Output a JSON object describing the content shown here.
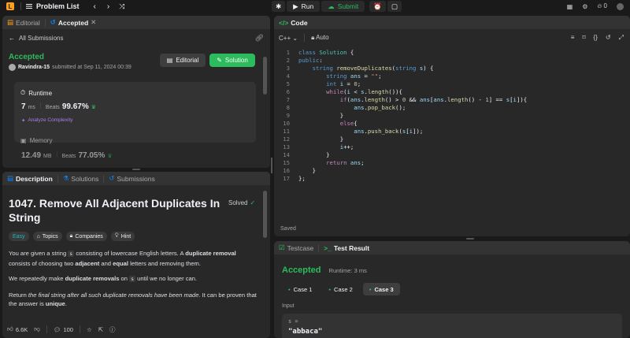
{
  "topbar": {
    "problem_list": "Problem List",
    "run": "Run",
    "submit": "Submit",
    "streak": "0"
  },
  "submission": {
    "tabs": {
      "editorial": "Editorial",
      "accepted": "Accepted"
    },
    "back": "All Submissions",
    "status": "Accepted",
    "user": "Ravindra-15",
    "submitted": "submitted at Sep 11, 2024 00:39",
    "editorial_btn": "Editorial",
    "solution_btn": "Solution",
    "runtime_title": "Runtime",
    "runtime_value": "7",
    "runtime_unit": "ms",
    "beats_label": "Beats",
    "runtime_beats": "99.67%",
    "analyze": "Analyze Complexity",
    "memory_title": "Memory",
    "memory_value": "12.49",
    "memory_unit": "MB",
    "memory_beats": "77.05%"
  },
  "description": {
    "tabs": {
      "description": "Description",
      "solutions": "Solutions",
      "submissions": "Submissions"
    },
    "title": "1047. Remove All Adjacent Duplicates In String",
    "solved": "Solved",
    "tags": {
      "difficulty": "Easy",
      "topics": "Topics",
      "companies": "Companies",
      "hint": "Hint"
    },
    "p1_a": "You are given a string ",
    "p1_s": "s",
    "p1_b": " consisting of lowercase English letters. A ",
    "p1_c": "duplicate removal",
    "p1_d": " consists of choosing two ",
    "p1_e": "adjacent",
    "p1_f": " and ",
    "p1_g": "equal",
    "p1_h": " letters and removing them.",
    "p2_a": "We repeatedly make ",
    "p2_b": "duplicate removals",
    "p2_c": " on ",
    "p2_s": "s",
    "p2_d": " until we no longer can.",
    "p3_a": "Return ",
    "p3_b": "the final string after all such duplicate removals have been made",
    "p3_c": ". It can be proven that the answer is ",
    "p3_d": "unique",
    "p3_e": ".",
    "likes": "6.6K",
    "comments": "100"
  },
  "code": {
    "title": "Code",
    "lang": "C++",
    "mode": "Auto",
    "saved": "Saved",
    "lines": [
      "1",
      "2",
      "3",
      "4",
      "5",
      "6",
      "7",
      "8",
      "9",
      "10",
      "11",
      "12",
      "13",
      "14",
      "15",
      "16",
      "17"
    ]
  },
  "result": {
    "tabs": {
      "testcase": "Testcase",
      "test_result": "Test Result"
    },
    "status": "Accepted",
    "runtime": "Runtime: 3 ms",
    "cases": [
      "Case 1",
      "Case 2",
      "Case 3"
    ],
    "input_label": "Input",
    "var": "s =",
    "value": "\"abbaca\""
  }
}
